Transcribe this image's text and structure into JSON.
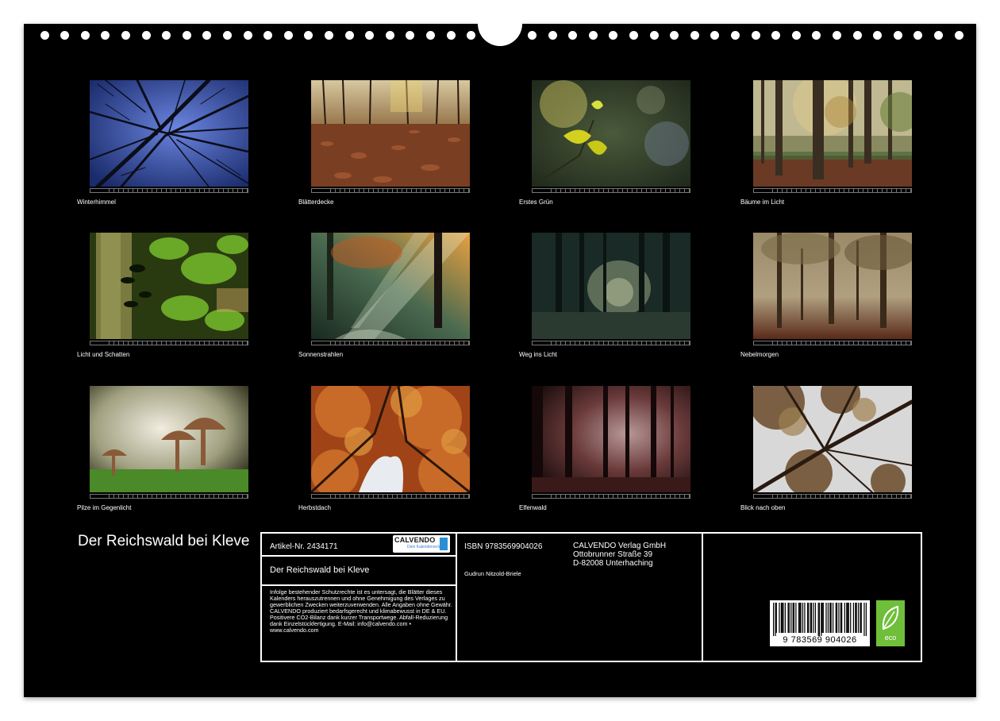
{
  "tiles": [
    {
      "caption": "Winterhimmel"
    },
    {
      "caption": "Blätterdecke"
    },
    {
      "caption": "Erstes Grün"
    },
    {
      "caption": "Bäume im Licht"
    },
    {
      "caption": "Licht und Schatten"
    },
    {
      "caption": "Sonnenstrahlen"
    },
    {
      "caption": "Weg ins Licht"
    },
    {
      "caption": "Nebelmorgen"
    },
    {
      "caption": "Pilze im Gegenlicht"
    },
    {
      "caption": "Herbstdach"
    },
    {
      "caption": "Elfenwald"
    },
    {
      "caption": "Blick nach oben"
    }
  ],
  "title": "Der Reichswald bei Kleve",
  "info": {
    "article": "Artikel-Nr. 2434171",
    "calendar_title": "Der Reichswald bei Kleve",
    "logo_title": "CALVENDO",
    "logo_sub": "Dein Kalenderverlag",
    "legal_text": "Infolge bestehender Schutzrechte ist es untersagt, die Blätter dieses Kalenders herauszutrennen und ohne Genehmigung des Verlages zu gewerblichen Zwecken weiterzuverwenden. Alle Angaben ohne Gewähr. CALVENDO produziert bedarfsgerecht und klimabewusst in DE & EU. Positivere CO2-Bilanz dank kurzer Transportwege. Abfall-Reduzierung dank Einzelstückfertigung. E-Mail: info@calvendo.com • www.calvendo.com",
    "isbn": "ISBN 9783569904026",
    "author": "Gudrun Nitzold-Briele",
    "publisher_name": "CALVENDO Verlag GmbH",
    "publisher_street": "Ottobrunner Straße 39",
    "publisher_city": "D-82008 Unterhaching",
    "barcode_number": "9 783569 904026",
    "eco_label": "eco"
  },
  "colors": {
    "background": "#000000",
    "text": "#ffffff",
    "eco_green": "#6fbf3a",
    "calvendo_blue": "#2a8fd6"
  },
  "icons": [
    "eco-leaf-icon",
    "calvendo-logo",
    "barcode"
  ]
}
